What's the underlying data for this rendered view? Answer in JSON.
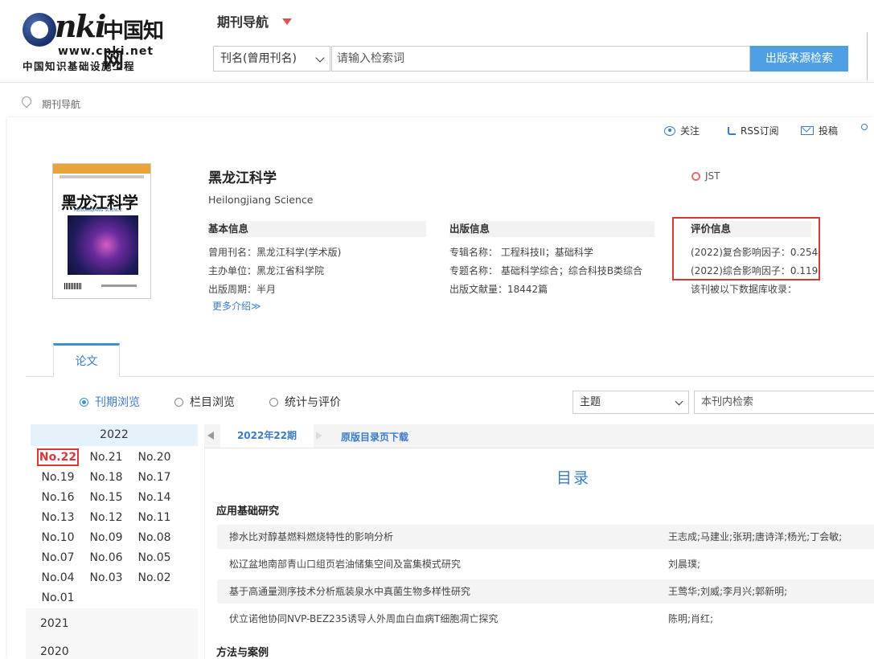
{
  "header": {
    "logo": {
      "brand": "CNKI",
      "brand_cn": "中国知网",
      "url": "www.cnki.net",
      "slogan": "中国知识基础设施工程"
    },
    "nav_title": "期刊导航",
    "search": {
      "field": "刊名(曾用刊名)",
      "placeholder": "请输入检索词",
      "button": "出版来源检索"
    }
  },
  "breadcrumb": "期刊导航",
  "toolbar": {
    "follow": "关注",
    "rss": "RSS订阅",
    "submit": "投稿"
  },
  "journal": {
    "title_cn": "黑龙江科学",
    "title_en": "Heilongjiang Science",
    "badge": "JST",
    "cover": {
      "title": "黑龙江科学",
      "subtitle": "HEILONGJIANG SCIENCE"
    },
    "basic": {
      "heading": "基本信息",
      "former_name": "曾用刊名：黑龙江科学(学术版)",
      "sponsor": "主办单位：黑龙江省科学院",
      "cycle": "出版周期：半月",
      "more": "更多介绍≫"
    },
    "publish": {
      "heading": "出版信息",
      "series": "专辑名称：  工程科技II；基础科学",
      "topics": "专题名称：  基础科学综合；综合科技B类综合",
      "count": "出版文献量：18442篇"
    },
    "evaluation": {
      "heading": "评价信息",
      "composite_if": "(2022)复合影响因子：0.254",
      "comprehensive_if": "(2022)综合影响因子：0.119",
      "db_note": "该刊被以下数据库收录："
    }
  },
  "tabs": {
    "papers": "论文"
  },
  "browse": {
    "options": [
      "刊期浏览",
      "栏目浏览",
      "统计与评价"
    ],
    "field": "主题",
    "search_placeholder": "本刊内检索"
  },
  "issues": {
    "year": "2022",
    "list": [
      "No.22",
      "No.21",
      "No.20",
      "No.19",
      "No.18",
      "No.17",
      "No.16",
      "No.15",
      "No.14",
      "No.13",
      "No.12",
      "No.11",
      "No.10",
      "No.09",
      "No.08",
      "No.07",
      "No.06",
      "No.05",
      "No.04",
      "No.03",
      "No.02",
      "No.01"
    ],
    "other_years": [
      "2021",
      "2020"
    ]
  },
  "content": {
    "current_issue": "2022年22期",
    "download": "原版目录页下载",
    "toc_title": "目录",
    "sections": [
      {
        "title": "应用基础研究",
        "articles": [
          {
            "title": "掺水比对醇基燃料燃烧特性的影响分析",
            "authors": "王志成;马建业;张玥;唐诗洋;杨光;丁会敏;"
          },
          {
            "title": "松辽盆地南部青山口组页岩油储集空间及富集模式研究",
            "authors": "刘晨璞;"
          },
          {
            "title": "基于高通量测序技术分析瓶装泉水中真菌生物多样性研究",
            "authors": "王莺华;刘威;李月兴;郭新明;"
          },
          {
            "title": "伏立诺他协同NVP-BEZ235诱导人外周血白血病T细胞凋亡探究",
            "authors": "陈明;肖红;"
          }
        ]
      },
      {
        "title": "方法与案例",
        "articles": []
      }
    ]
  }
}
